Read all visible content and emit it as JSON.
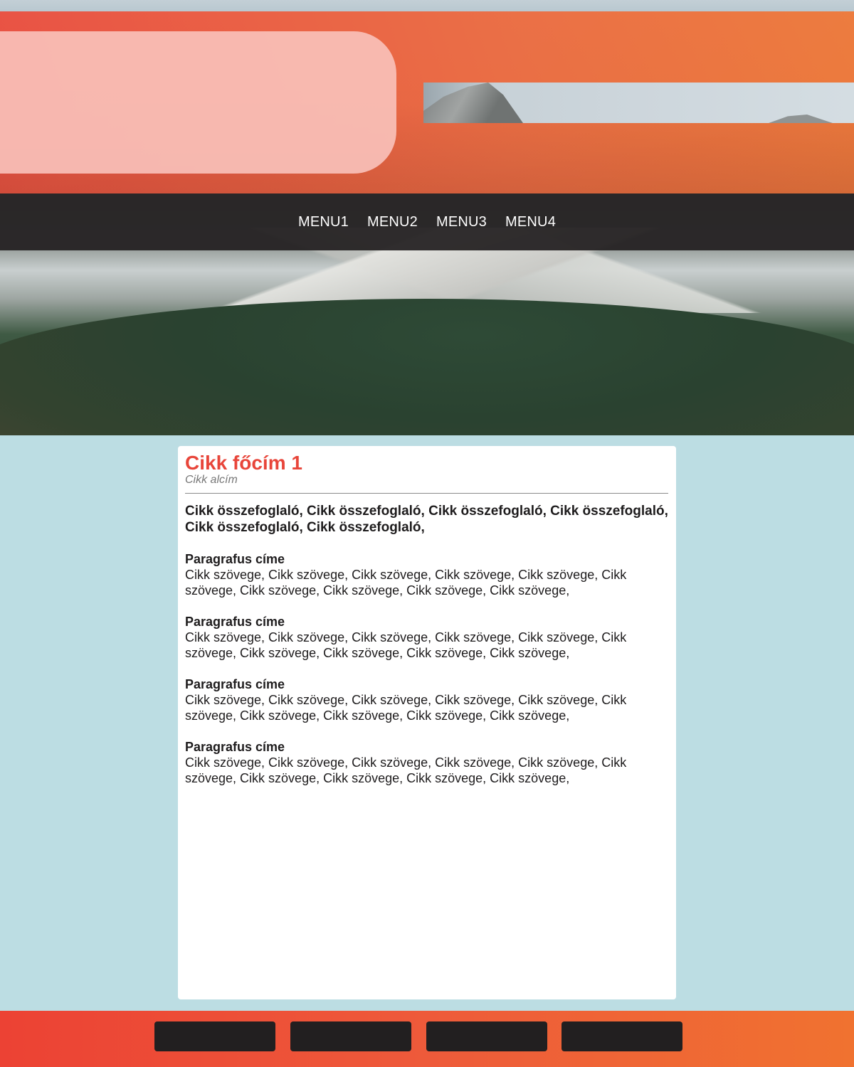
{
  "nav": {
    "items": [
      {
        "label": "MENU1"
      },
      {
        "label": "MENU2"
      },
      {
        "label": "MENU3"
      },
      {
        "label": "MENU4"
      }
    ]
  },
  "article": {
    "title": "Cikk főcím 1",
    "subtitle": "Cikk alcím",
    "summary": "Cikk összefoglaló, Cikk összefoglaló, Cikk összefoglaló, Cikk összefoglaló, Cikk összefoglaló, Cikk összefoglaló,",
    "paragraphs": [
      {
        "heading": "Paragrafus címe",
        "text": "Cikk szövege, Cikk szövege, Cikk szövege, Cikk szövege, Cikk szövege, Cikk szövege, Cikk szövege, Cikk szövege, Cikk szövege, Cikk szövege,"
      },
      {
        "heading": "Paragrafus címe",
        "text": "Cikk szövege, Cikk szövege, Cikk szövege, Cikk szövege, Cikk szövege, Cikk szövege, Cikk szövege, Cikk szövege, Cikk szövege, Cikk szövege,"
      },
      {
        "heading": "Paragrafus címe",
        "text": "Cikk szövege, Cikk szövege, Cikk szövege, Cikk szövege, Cikk szövege, Cikk szövege, Cikk szövege, Cikk szövege, Cikk szövege, Cikk szövege,"
      },
      {
        "heading": "Paragrafus címe",
        "text": "Cikk szövege, Cikk szövege, Cikk szövege, Cikk szövege, Cikk szövege, Cikk szövege, Cikk szövege, Cikk szövege, Cikk szövege, Cikk szövege,"
      }
    ]
  },
  "colors": {
    "accent": "#e8453a",
    "orange": "#f07736",
    "dark": "#221f20",
    "background": "#bcdde3"
  }
}
